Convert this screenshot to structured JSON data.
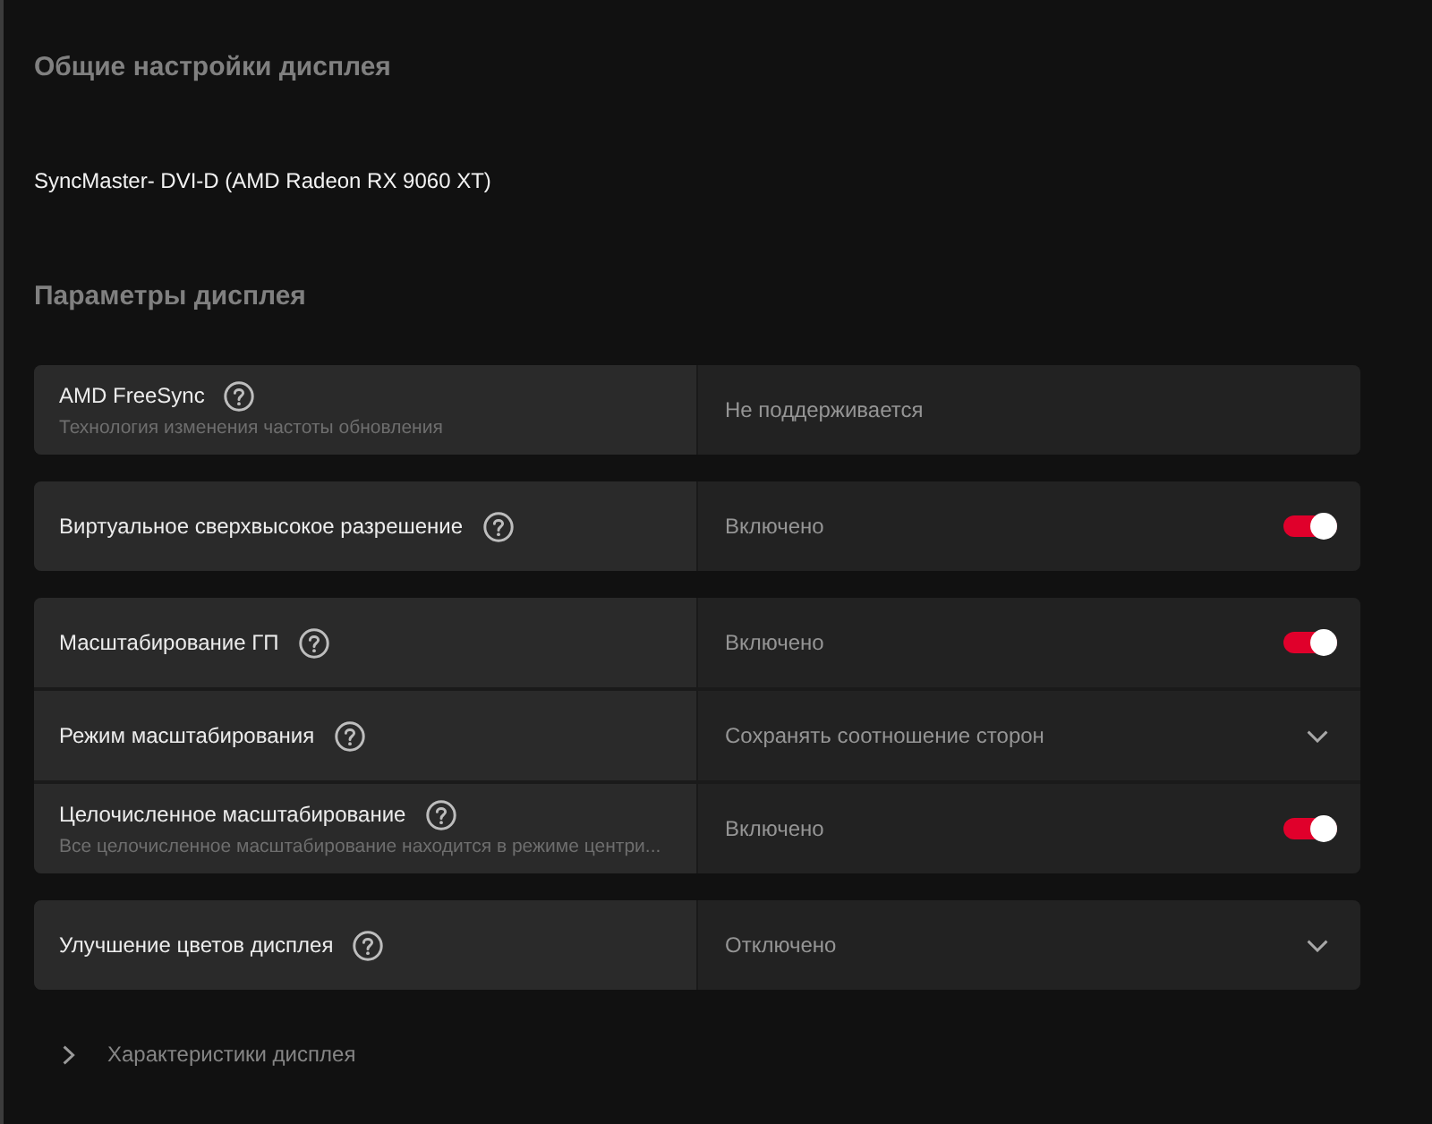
{
  "general": {
    "heading": "Общие настройки дисплея",
    "display_name": "SyncMaster- DVI-D (AMD Radeon RX 9060 XT)"
  },
  "parameters": {
    "heading": "Параметры дисплея",
    "groups": [
      {
        "rows": [
          {
            "kind": "text",
            "label": "AMD FreeSync",
            "description": "Технология изменения частоты обновления",
            "value": "Не поддерживается"
          }
        ]
      },
      {
        "rows": [
          {
            "kind": "toggle",
            "label": "Виртуальное сверхвысокое разрешение",
            "value": "Включено",
            "on": true
          }
        ]
      },
      {
        "rows": [
          {
            "kind": "toggle",
            "label": "Масштабирование ГП",
            "value": "Включено",
            "on": true
          },
          {
            "kind": "dropdown",
            "label": "Режим масштабирования",
            "value": "Сохранять соотношение сторон"
          },
          {
            "kind": "toggle",
            "label": "Целочисленное масштабирование",
            "description": "Все целочисленное масштабирование находится в режиме центри...",
            "value": "Включено",
            "on": true
          }
        ]
      },
      {
        "rows": [
          {
            "kind": "dropdown",
            "label": "Улучшение цветов дисплея",
            "value": "Отключено"
          }
        ]
      }
    ]
  },
  "details": {
    "label": "Характеристики дисплея",
    "expanded": false
  }
}
